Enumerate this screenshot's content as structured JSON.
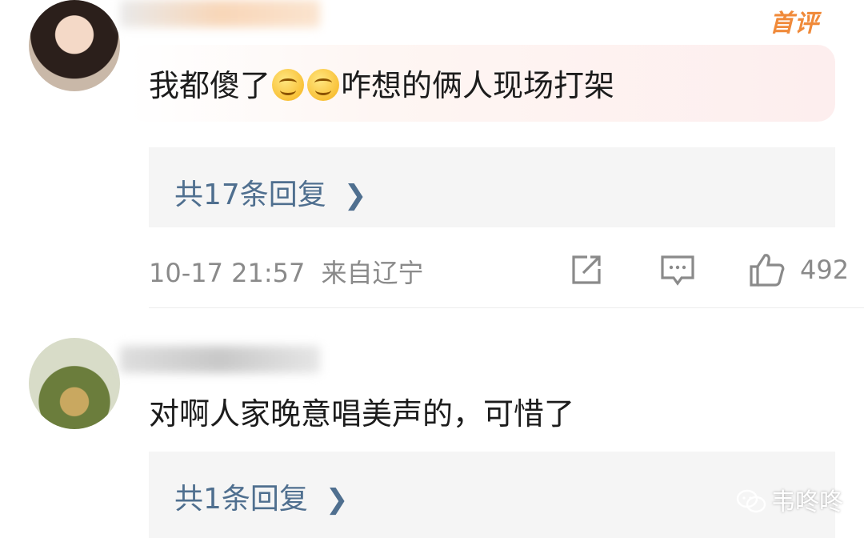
{
  "comments": [
    {
      "badge": "首评",
      "text_before": "我都傻了",
      "emoji": "smile-emoji",
      "text_after": "咋想的俩人现场打架",
      "reply_link": "共17条回复",
      "timestamp": "10-17 21:57",
      "location": "来自辽宁",
      "likes": "492"
    },
    {
      "text": "对啊人家晚意唱美声的，可惜了",
      "reply_link": "共1条回复"
    }
  ],
  "watermark": {
    "label": "韦咚咚",
    "icon": "wechat-icon"
  },
  "icons": {
    "share": "share-icon",
    "comment": "comment-icon",
    "like": "thumbs-up-icon",
    "chevron": "chevron-right-icon"
  },
  "colors": {
    "link": "#4f6f8f",
    "badge": "#f08a3a",
    "meta": "#8a8a8a",
    "reply_bg": "#f5f5f5"
  }
}
